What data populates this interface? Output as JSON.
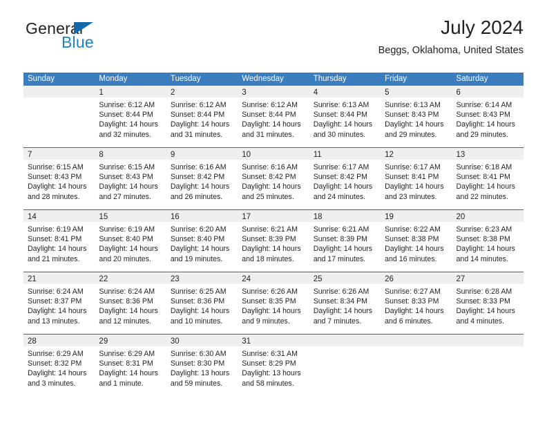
{
  "brand": {
    "name_part1": "General",
    "name_part2": "Blue",
    "triangle_color": "#1468a8",
    "blue_color": "#1f7fc4"
  },
  "header": {
    "title": "July 2024",
    "subtitle": "Beggs, Oklahoma, United States"
  },
  "theme": {
    "header_bar_color": "#3a7ebf",
    "row_divider_color": "#2a6ba8",
    "day_strip_color": "#efefef",
    "text_color": "#231f20"
  },
  "weekdays": [
    "Sunday",
    "Monday",
    "Tuesday",
    "Wednesday",
    "Thursday",
    "Friday",
    "Saturday"
  ],
  "weeks": [
    [
      {
        "day": "",
        "lines": [
          "",
          "",
          "",
          ""
        ]
      },
      {
        "day": "1",
        "lines": [
          "Sunrise: 6:12 AM",
          "Sunset: 8:44 PM",
          "Daylight: 14 hours",
          "and 32 minutes."
        ]
      },
      {
        "day": "2",
        "lines": [
          "Sunrise: 6:12 AM",
          "Sunset: 8:44 PM",
          "Daylight: 14 hours",
          "and 31 minutes."
        ]
      },
      {
        "day": "3",
        "lines": [
          "Sunrise: 6:12 AM",
          "Sunset: 8:44 PM",
          "Daylight: 14 hours",
          "and 31 minutes."
        ]
      },
      {
        "day": "4",
        "lines": [
          "Sunrise: 6:13 AM",
          "Sunset: 8:44 PM",
          "Daylight: 14 hours",
          "and 30 minutes."
        ]
      },
      {
        "day": "5",
        "lines": [
          "Sunrise: 6:13 AM",
          "Sunset: 8:43 PM",
          "Daylight: 14 hours",
          "and 29 minutes."
        ]
      },
      {
        "day": "6",
        "lines": [
          "Sunrise: 6:14 AM",
          "Sunset: 8:43 PM",
          "Daylight: 14 hours",
          "and 29 minutes."
        ]
      }
    ],
    [
      {
        "day": "7",
        "lines": [
          "Sunrise: 6:15 AM",
          "Sunset: 8:43 PM",
          "Daylight: 14 hours",
          "and 28 minutes."
        ]
      },
      {
        "day": "8",
        "lines": [
          "Sunrise: 6:15 AM",
          "Sunset: 8:43 PM",
          "Daylight: 14 hours",
          "and 27 minutes."
        ]
      },
      {
        "day": "9",
        "lines": [
          "Sunrise: 6:16 AM",
          "Sunset: 8:42 PM",
          "Daylight: 14 hours",
          "and 26 minutes."
        ]
      },
      {
        "day": "10",
        "lines": [
          "Sunrise: 6:16 AM",
          "Sunset: 8:42 PM",
          "Daylight: 14 hours",
          "and 25 minutes."
        ]
      },
      {
        "day": "11",
        "lines": [
          "Sunrise: 6:17 AM",
          "Sunset: 8:42 PM",
          "Daylight: 14 hours",
          "and 24 minutes."
        ]
      },
      {
        "day": "12",
        "lines": [
          "Sunrise: 6:17 AM",
          "Sunset: 8:41 PM",
          "Daylight: 14 hours",
          "and 23 minutes."
        ]
      },
      {
        "day": "13",
        "lines": [
          "Sunrise: 6:18 AM",
          "Sunset: 8:41 PM",
          "Daylight: 14 hours",
          "and 22 minutes."
        ]
      }
    ],
    [
      {
        "day": "14",
        "lines": [
          "Sunrise: 6:19 AM",
          "Sunset: 8:41 PM",
          "Daylight: 14 hours",
          "and 21 minutes."
        ]
      },
      {
        "day": "15",
        "lines": [
          "Sunrise: 6:19 AM",
          "Sunset: 8:40 PM",
          "Daylight: 14 hours",
          "and 20 minutes."
        ]
      },
      {
        "day": "16",
        "lines": [
          "Sunrise: 6:20 AM",
          "Sunset: 8:40 PM",
          "Daylight: 14 hours",
          "and 19 minutes."
        ]
      },
      {
        "day": "17",
        "lines": [
          "Sunrise: 6:21 AM",
          "Sunset: 8:39 PM",
          "Daylight: 14 hours",
          "and 18 minutes."
        ]
      },
      {
        "day": "18",
        "lines": [
          "Sunrise: 6:21 AM",
          "Sunset: 8:39 PM",
          "Daylight: 14 hours",
          "and 17 minutes."
        ]
      },
      {
        "day": "19",
        "lines": [
          "Sunrise: 6:22 AM",
          "Sunset: 8:38 PM",
          "Daylight: 14 hours",
          "and 16 minutes."
        ]
      },
      {
        "day": "20",
        "lines": [
          "Sunrise: 6:23 AM",
          "Sunset: 8:38 PM",
          "Daylight: 14 hours",
          "and 14 minutes."
        ]
      }
    ],
    [
      {
        "day": "21",
        "lines": [
          "Sunrise: 6:24 AM",
          "Sunset: 8:37 PM",
          "Daylight: 14 hours",
          "and 13 minutes."
        ]
      },
      {
        "day": "22",
        "lines": [
          "Sunrise: 6:24 AM",
          "Sunset: 8:36 PM",
          "Daylight: 14 hours",
          "and 12 minutes."
        ]
      },
      {
        "day": "23",
        "lines": [
          "Sunrise: 6:25 AM",
          "Sunset: 8:36 PM",
          "Daylight: 14 hours",
          "and 10 minutes."
        ]
      },
      {
        "day": "24",
        "lines": [
          "Sunrise: 6:26 AM",
          "Sunset: 8:35 PM",
          "Daylight: 14 hours",
          "and 9 minutes."
        ]
      },
      {
        "day": "25",
        "lines": [
          "Sunrise: 6:26 AM",
          "Sunset: 8:34 PM",
          "Daylight: 14 hours",
          "and 7 minutes."
        ]
      },
      {
        "day": "26",
        "lines": [
          "Sunrise: 6:27 AM",
          "Sunset: 8:33 PM",
          "Daylight: 14 hours",
          "and 6 minutes."
        ]
      },
      {
        "day": "27",
        "lines": [
          "Sunrise: 6:28 AM",
          "Sunset: 8:33 PM",
          "Daylight: 14 hours",
          "and 4 minutes."
        ]
      }
    ],
    [
      {
        "day": "28",
        "lines": [
          "Sunrise: 6:29 AM",
          "Sunset: 8:32 PM",
          "Daylight: 14 hours",
          "and 3 minutes."
        ]
      },
      {
        "day": "29",
        "lines": [
          "Sunrise: 6:29 AM",
          "Sunset: 8:31 PM",
          "Daylight: 14 hours",
          "and 1 minute."
        ]
      },
      {
        "day": "30",
        "lines": [
          "Sunrise: 6:30 AM",
          "Sunset: 8:30 PM",
          "Daylight: 13 hours",
          "and 59 minutes."
        ]
      },
      {
        "day": "31",
        "lines": [
          "Sunrise: 6:31 AM",
          "Sunset: 8:29 PM",
          "Daylight: 13 hours",
          "and 58 minutes."
        ]
      },
      {
        "day": "",
        "lines": [
          "",
          "",
          "",
          ""
        ]
      },
      {
        "day": "",
        "lines": [
          "",
          "",
          "",
          ""
        ]
      },
      {
        "day": "",
        "lines": [
          "",
          "",
          "",
          ""
        ]
      }
    ]
  ]
}
